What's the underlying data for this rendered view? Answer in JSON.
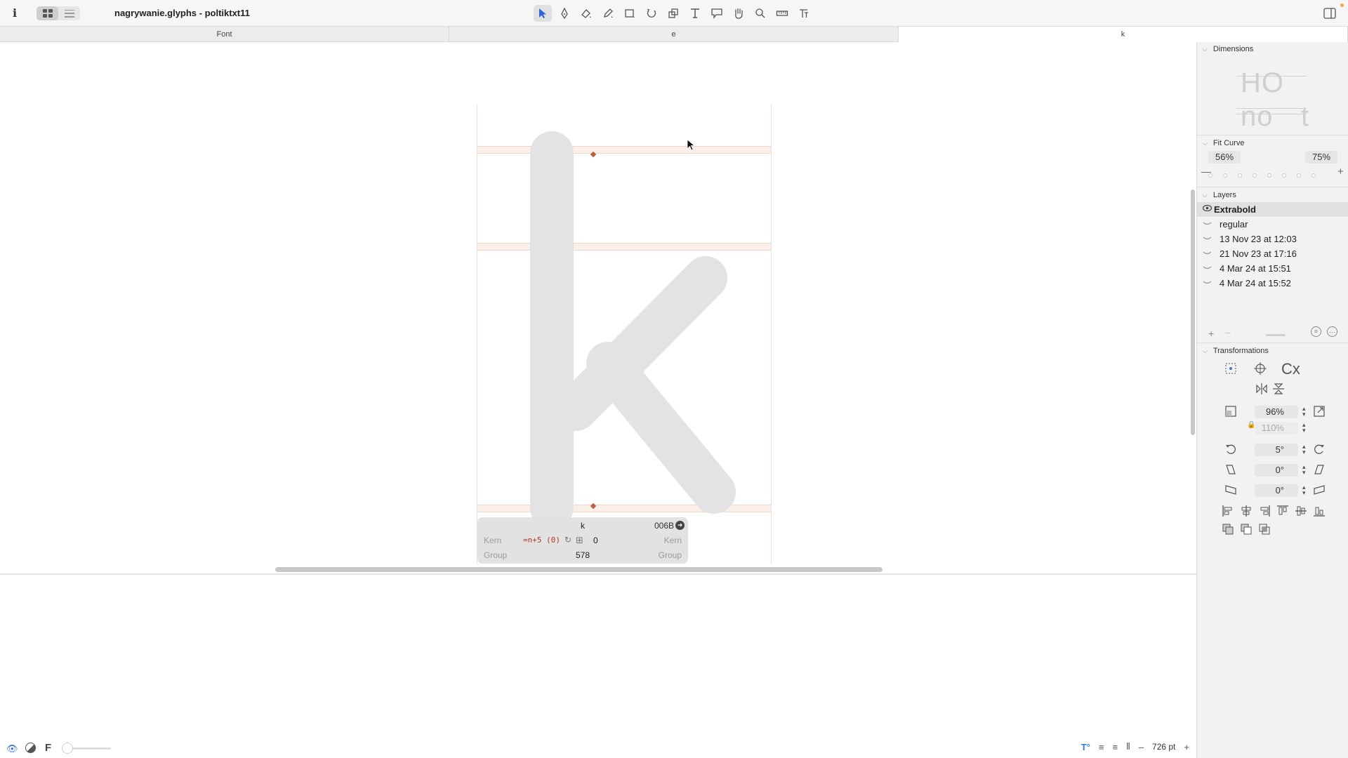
{
  "app": {
    "info_icon": "i",
    "document_title": "nagrywanie.glyphs - poltiktxt11"
  },
  "toolbar": {
    "view_modes": [
      "grid-view-icon",
      "list-view-icon"
    ],
    "tools": [
      "select-tool-icon",
      "draw-tool-icon",
      "eraser-tool-icon",
      "pencil-tool-icon",
      "rectangle-tool-icon",
      "rotate-tool-icon",
      "scale-tool-icon",
      "text-tool-icon",
      "annotation-tool-icon",
      "hand-tool-icon",
      "zoom-tool-icon",
      "measure-tool-icon",
      "type-tool-icon"
    ]
  },
  "tabs": [
    {
      "label": "Font",
      "active": false
    },
    {
      "label": "e",
      "active": false
    },
    {
      "label": "k",
      "active": true
    }
  ],
  "glyph": {
    "name": "k",
    "unicode": "006B",
    "kern_label_left": "Kern",
    "kern_label_right": "Kern",
    "kern_value": "=n+5 (0)",
    "kern_right_value": "0",
    "group_label_left": "Group",
    "group_label_right": "Group",
    "width": "578"
  },
  "bottom_bar": {
    "font_label": "F",
    "zoom": "726 pt",
    "minus": "–",
    "plus": "+"
  },
  "panel": {
    "dimensions": {
      "title": "Dimensions",
      "preview_top": "HO",
      "preview_bottom_left": "no",
      "preview_bottom_right": "t"
    },
    "fit_curve": {
      "title": "Fit Curve",
      "left": "56%",
      "right": "75%",
      "minus": "—",
      "plus": "+"
    },
    "layers": {
      "title": "Layers",
      "items": [
        {
          "label": "Extrabold",
          "active": true
        },
        {
          "label": "regular",
          "active": false
        },
        {
          "label": "13 Nov 23 at 12:03",
          "active": false
        },
        {
          "label": "21 Nov 23 at 17:16",
          "active": false
        },
        {
          "label": "4 Mar 24 at 15:51",
          "active": false
        },
        {
          "label": "4 Mar 24 at 15:52",
          "active": false
        }
      ],
      "add": "+",
      "remove": "–"
    },
    "transformations": {
      "title": "Transformations",
      "scale": "96%",
      "scale_y": "110%",
      "rotate": "5°",
      "slant_x": "0°",
      "slant_y": "0°",
      "center_label": "Cx"
    }
  },
  "colors": {
    "accent": "#3a78d8",
    "glyph_fill": "#e3e3e3",
    "metric_band": "#eec8af",
    "kern_red": "#b23a2a",
    "node": "#c06040"
  }
}
